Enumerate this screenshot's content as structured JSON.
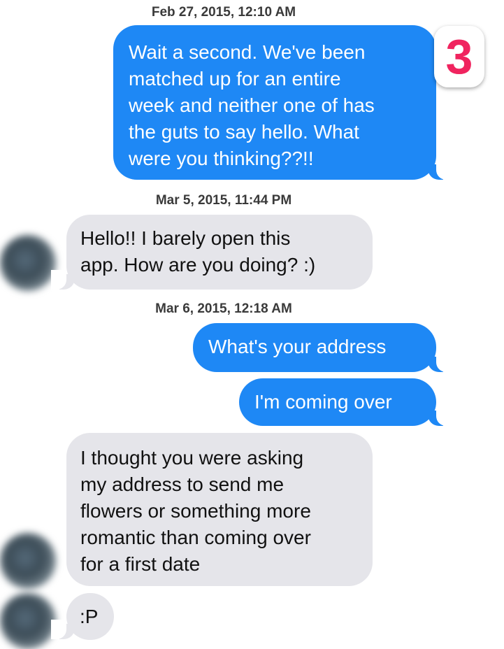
{
  "timestamps": [
    "Feb 27, 2015, 12:10 AM",
    "Mar 5, 2015, 11:44 PM",
    "Mar 6, 2015, 12:18 AM"
  ],
  "messages": [
    {
      "from": "me",
      "lines": [
        "Wait a second.  We've been",
        "matched up for an entire",
        "week and neither one of has",
        "the guts to say hello. What",
        "were you thinking??!!"
      ]
    },
    {
      "from": "them",
      "lines": [
        "Hello!! I barely open this",
        "app. How are you doing? :)"
      ]
    },
    {
      "from": "me",
      "lines": [
        "What's your address"
      ]
    },
    {
      "from": "me",
      "lines": [
        "I'm coming over"
      ]
    },
    {
      "from": "them",
      "lines": [
        "I thought you were asking",
        "my address to send me",
        "flowers or something more",
        "romantic than coming over",
        "for a first date"
      ]
    },
    {
      "from": "them",
      "lines": [
        ":P"
      ]
    }
  ],
  "badge": {
    "number": "3"
  },
  "colors": {
    "outgoing": "#1e88f5",
    "incoming": "#e5e5ea",
    "badge": "#f0245f"
  }
}
